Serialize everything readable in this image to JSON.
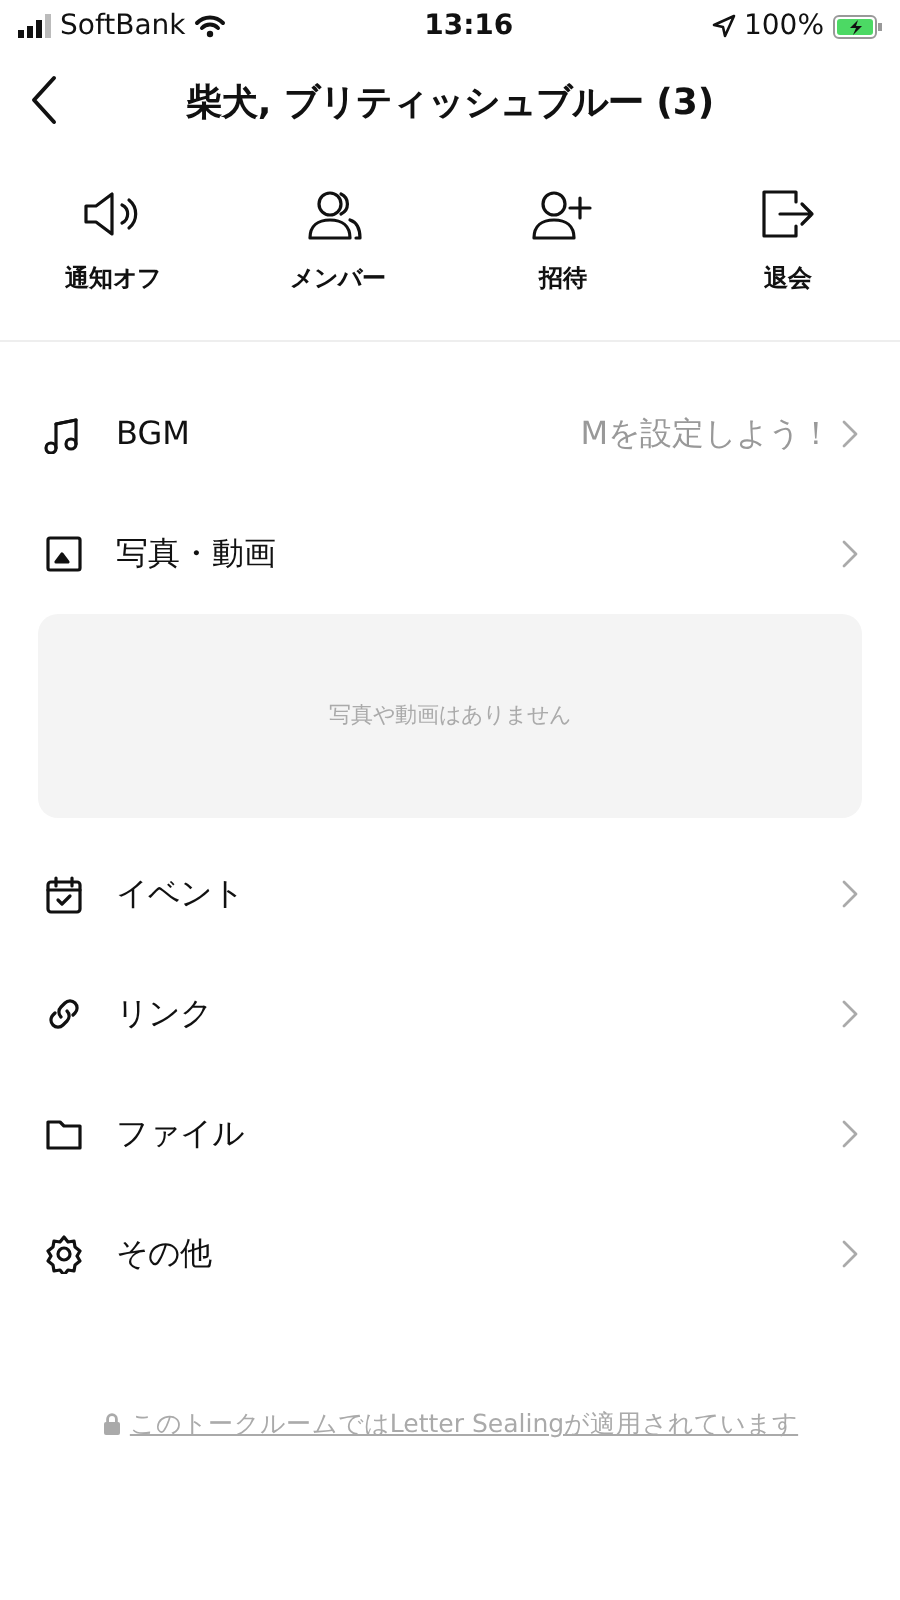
{
  "status_bar": {
    "carrier": "SoftBank",
    "time": "13:16",
    "battery": "100%"
  },
  "header": {
    "title": "柴犬, ブリティッシュブルー (3)"
  },
  "actions": [
    {
      "label": "通知オフ"
    },
    {
      "label": "メンバー"
    },
    {
      "label": "招待"
    },
    {
      "label": "退会"
    }
  ],
  "menu": [
    {
      "label": "BGM",
      "value": "Mを設定しよう！"
    },
    {
      "label": "写真・動画",
      "empty_message": "写真や動画はありません"
    },
    {
      "label": "イベント"
    },
    {
      "label": "リンク"
    },
    {
      "label": "ファイル"
    },
    {
      "label": "その他"
    }
  ],
  "footer": {
    "notice": "このトークルームではLetter Sealingが適用されています"
  }
}
